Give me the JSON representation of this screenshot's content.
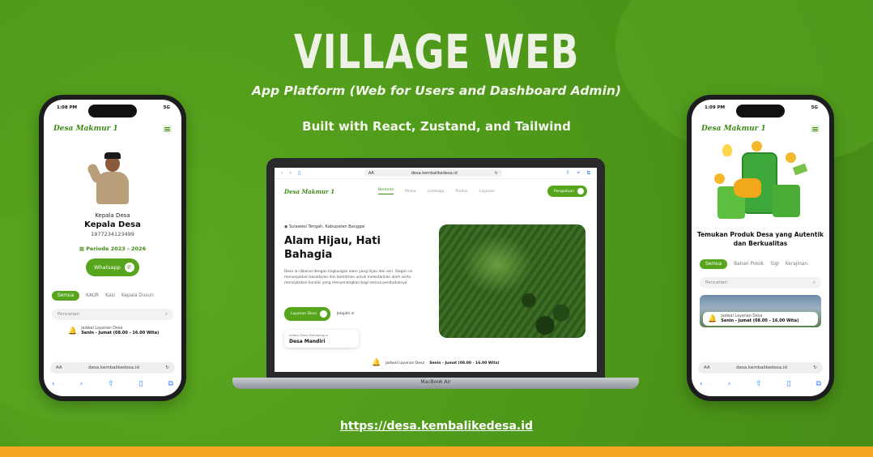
{
  "hero": {
    "title": "VILLAGE WEB",
    "subtitle": "App Platform (Web for Users and Dashboard Admin)",
    "tagline": "Built with React, Zustand, and Tailwind",
    "link": "https://desa.kembalikedesa.id"
  },
  "colors": {
    "background": "#4f9a1a",
    "accent": "#56a51d",
    "bottom_bar": "#f5a623"
  },
  "phone_left": {
    "time": "1:08 PM",
    "signal": "5G",
    "brand": "Desa Makmur 1",
    "menu_icon": "hamburger-icon",
    "role_small": "Kepala Desa",
    "role_big": "Kepala Desa",
    "nip": "1977234123499",
    "periode": "Periode 2023 - 2026",
    "whatsapp_label": "Whatsapp",
    "chips": [
      "Semua",
      "KAUR",
      "Kasi",
      "Kepala Dusun"
    ],
    "search_placeholder": "Pencarian",
    "schedule_label": "Jadwal Layanan Desa",
    "schedule_value": "Senin - Jumat (08.00 - 16.00 Wita)",
    "address": "desa.kembalikedesa.id"
  },
  "laptop": {
    "address": "desa.kembalikedesa.id",
    "brand": "Desa Makmur 1",
    "nav": [
      "Beranda",
      "Media",
      "Lembaga",
      "Produk",
      "Layanan"
    ],
    "cta": "Pengaduan",
    "location": "Sulawesi Tengah, Kabupaten Banggai",
    "title": "Alam Hijau, Hati Bahagia",
    "description": "Desa ini dikenal dengan lingkungan alam yang hijau dan asri. Slogan ini menunjukkan kesadaran dan komitmen untuk melestarikan alam serta menciptakan kondisi yang menyenangkan bagi semua penduduknya.",
    "primary_button": "Layanan Desa",
    "secondary_button": "Jelajahi",
    "idm_label": "Indeks Desa Membangun",
    "idm_value": "Desa Mandiri",
    "schedule_label": "Jadwal Layanan Desa",
    "schedule_value": "Senin - Jumat (08.00 - 16.00 Wita)",
    "device": "MacBook Air"
  },
  "phone_right": {
    "time": "1:09 PM",
    "signal": "5G",
    "brand": "Desa Makmur 1",
    "product_title": "Temukan Produk Desa yang Autentik dan Berkualitas",
    "chips": [
      "Semua",
      "Bahan Pokok",
      "Sigi",
      "Kerajinan"
    ],
    "search_placeholder": "Pencarian",
    "schedule_label": "Jadwal Layanan Desa",
    "schedule_value": "Senin - Jumat (08.00 - 16.00 Wita)",
    "address": "desa.kembalikedesa.id"
  }
}
